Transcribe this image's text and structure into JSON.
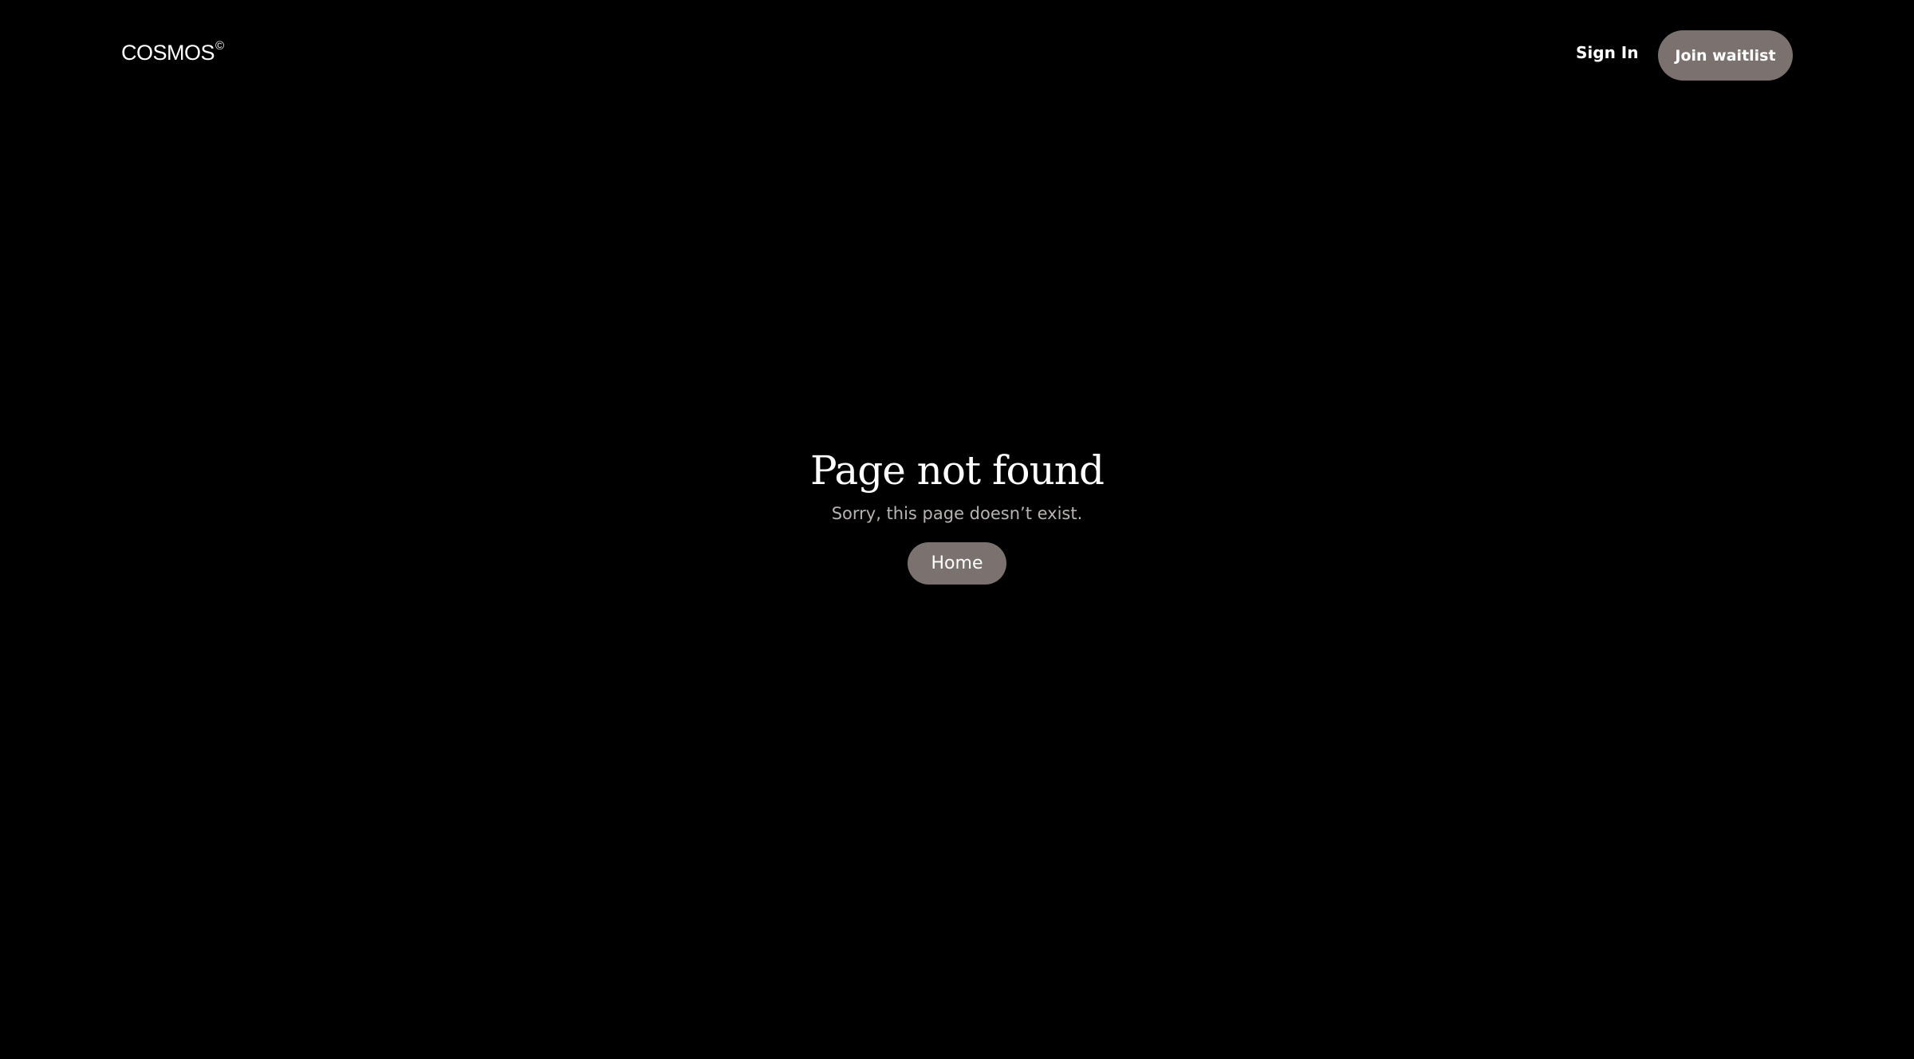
{
  "header": {
    "logo_text": "COSMOS",
    "logo_mark": "©",
    "signin_label": "Sign In",
    "waitlist_label": "Join waitlist"
  },
  "main": {
    "title": "Page not found",
    "subtitle": "Sorry, this page doesn’t exist.",
    "home_label": "Home"
  },
  "colors": {
    "background": "#000000",
    "button": "#7b7270",
    "text": "#ffffff",
    "muted_text": "#b9b3b1"
  }
}
